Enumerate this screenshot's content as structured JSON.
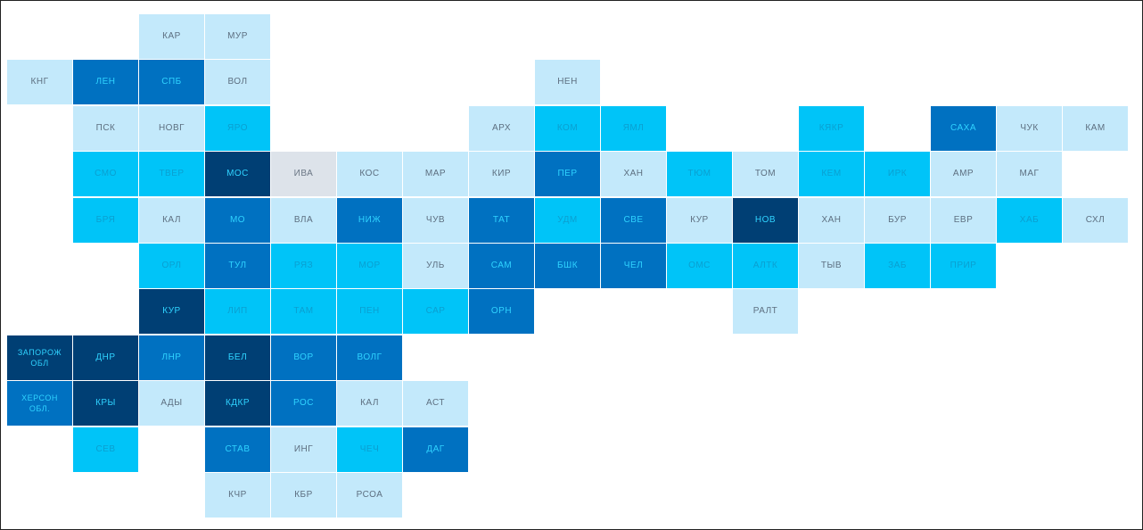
{
  "legend_colors": {
    "0": {
      "fill": "#dde3ea",
      "text": "#6b7785"
    },
    "1": {
      "fill": "#c3e9fb",
      "text": "#5d6f80"
    },
    "2": {
      "fill": "#00c4f8",
      "text": "#0a9fd0"
    },
    "3": {
      "fill": "#0071c1",
      "text": "#2fd3ff"
    },
    "4": {
      "fill": "#003f74",
      "text": "#2fd3ff"
    }
  },
  "tiles": [
    {
      "label": "КАР",
      "row": 0,
      "col": 2,
      "level": 1
    },
    {
      "label": "МУР",
      "row": 0,
      "col": 3,
      "level": 1
    },
    {
      "label": "КНГ",
      "row": 1,
      "col": 0,
      "level": 1
    },
    {
      "label": "ЛЕН",
      "row": 1,
      "col": 1,
      "level": 3
    },
    {
      "label": "СПБ",
      "row": 1,
      "col": 2,
      "level": 3
    },
    {
      "label": "ВОЛ",
      "row": 1,
      "col": 3,
      "level": 1
    },
    {
      "label": "НЕН",
      "row": 1,
      "col": 8,
      "level": 1
    },
    {
      "label": "ПСК",
      "row": 2,
      "col": 1,
      "level": 1
    },
    {
      "label": "НОВГ",
      "row": 2,
      "col": 2,
      "level": 1
    },
    {
      "label": "ЯРО",
      "row": 2,
      "col": 3,
      "level": 2
    },
    {
      "label": "АРХ",
      "row": 2,
      "col": 7,
      "level": 1
    },
    {
      "label": "КОМ",
      "row": 2,
      "col": 8,
      "level": 2
    },
    {
      "label": "ЯМЛ",
      "row": 2,
      "col": 9,
      "level": 2
    },
    {
      "label": "КЯКР",
      "row": 2,
      "col": 12,
      "level": 2
    },
    {
      "label": "САХА",
      "row": 2,
      "col": 14,
      "level": 3
    },
    {
      "label": "ЧУК",
      "row": 2,
      "col": 15,
      "level": 1
    },
    {
      "label": "КАМ",
      "row": 2,
      "col": 16,
      "level": 1
    },
    {
      "label": "СМО",
      "row": 3,
      "col": 1,
      "level": 2
    },
    {
      "label": "ТВЕР",
      "row": 3,
      "col": 2,
      "level": 2
    },
    {
      "label": "МОС",
      "row": 3,
      "col": 3,
      "level": 4
    },
    {
      "label": "ИВА",
      "row": 3,
      "col": 4,
      "level": 0
    },
    {
      "label": "КОС",
      "row": 3,
      "col": 5,
      "level": 1
    },
    {
      "label": "МАР",
      "row": 3,
      "col": 6,
      "level": 1
    },
    {
      "label": "КИР",
      "row": 3,
      "col": 7,
      "level": 1
    },
    {
      "label": "ПЕР",
      "row": 3,
      "col": 8,
      "level": 3
    },
    {
      "label": "ХАН",
      "row": 3,
      "col": 9,
      "level": 1
    },
    {
      "label": "ТЮМ",
      "row": 3,
      "col": 10,
      "level": 2
    },
    {
      "label": "ТОМ",
      "row": 3,
      "col": 11,
      "level": 1
    },
    {
      "label": "КЕМ",
      "row": 3,
      "col": 12,
      "level": 2
    },
    {
      "label": "ИРК",
      "row": 3,
      "col": 13,
      "level": 2
    },
    {
      "label": "АМР",
      "row": 3,
      "col": 14,
      "level": 1
    },
    {
      "label": "МАГ",
      "row": 3,
      "col": 15,
      "level": 1
    },
    {
      "label": "БРЯ",
      "row": 4,
      "col": 1,
      "level": 2
    },
    {
      "label": "КАЛ",
      "row": 4,
      "col": 2,
      "level": 1
    },
    {
      "label": "МО",
      "row": 4,
      "col": 3,
      "level": 3
    },
    {
      "label": "ВЛА",
      "row": 4,
      "col": 4,
      "level": 1
    },
    {
      "label": "НИЖ",
      "row": 4,
      "col": 5,
      "level": 3
    },
    {
      "label": "ЧУВ",
      "row": 4,
      "col": 6,
      "level": 1
    },
    {
      "label": "ТАТ",
      "row": 4,
      "col": 7,
      "level": 3
    },
    {
      "label": "УДМ",
      "row": 4,
      "col": 8,
      "level": 2
    },
    {
      "label": "СВЕ",
      "row": 4,
      "col": 9,
      "level": 3
    },
    {
      "label": "КУР",
      "row": 4,
      "col": 10,
      "level": 1
    },
    {
      "label": "НОВ",
      "row": 4,
      "col": 11,
      "level": 4
    },
    {
      "label": "ХАН",
      "row": 4,
      "col": 12,
      "level": 1
    },
    {
      "label": "БУР",
      "row": 4,
      "col": 13,
      "level": 1
    },
    {
      "label": "ЕВР",
      "row": 4,
      "col": 14,
      "level": 1
    },
    {
      "label": "ХАБ",
      "row": 4,
      "col": 15,
      "level": 2
    },
    {
      "label": "СХЛ",
      "row": 4,
      "col": 16,
      "level": 1
    },
    {
      "label": "ОРЛ",
      "row": 5,
      "col": 2,
      "level": 2
    },
    {
      "label": "ТУЛ",
      "row": 5,
      "col": 3,
      "level": 3
    },
    {
      "label": "РЯЗ",
      "row": 5,
      "col": 4,
      "level": 2
    },
    {
      "label": "МОР",
      "row": 5,
      "col": 5,
      "level": 2
    },
    {
      "label": "УЛЬ",
      "row": 5,
      "col": 6,
      "level": 1
    },
    {
      "label": "САМ",
      "row": 5,
      "col": 7,
      "level": 3
    },
    {
      "label": "БШК",
      "row": 5,
      "col": 8,
      "level": 3
    },
    {
      "label": "ЧЕЛ",
      "row": 5,
      "col": 9,
      "level": 3
    },
    {
      "label": "ОМС",
      "row": 5,
      "col": 10,
      "level": 2
    },
    {
      "label": "АЛТК",
      "row": 5,
      "col": 11,
      "level": 2
    },
    {
      "label": "ТЫВ",
      "row": 5,
      "col": 12,
      "level": 1
    },
    {
      "label": "ЗАБ",
      "row": 5,
      "col": 13,
      "level": 2
    },
    {
      "label": "ПРИР",
      "row": 5,
      "col": 14,
      "level": 2
    },
    {
      "label": "КУР",
      "row": 6,
      "col": 2,
      "level": 4
    },
    {
      "label": "ЛИП",
      "row": 6,
      "col": 3,
      "level": 2
    },
    {
      "label": "ТАМ",
      "row": 6,
      "col": 4,
      "level": 2
    },
    {
      "label": "ПЕН",
      "row": 6,
      "col": 5,
      "level": 2
    },
    {
      "label": "САР",
      "row": 6,
      "col": 6,
      "level": 2
    },
    {
      "label": "ОРН",
      "row": 6,
      "col": 7,
      "level": 3
    },
    {
      "label": "РАЛТ",
      "row": 6,
      "col": 11,
      "level": 1
    },
    {
      "label": "ЗАПОРОЖ ОБЛ",
      "row": 7,
      "col": 0,
      "level": 4
    },
    {
      "label": "ДНР",
      "row": 7,
      "col": 1,
      "level": 4
    },
    {
      "label": "ЛНР",
      "row": 7,
      "col": 2,
      "level": 3
    },
    {
      "label": "БЕЛ",
      "row": 7,
      "col": 3,
      "level": 4
    },
    {
      "label": "ВОР",
      "row": 7,
      "col": 4,
      "level": 3
    },
    {
      "label": "ВОЛГ",
      "row": 7,
      "col": 5,
      "level": 3
    },
    {
      "label": "ХЕРСОН ОБЛ.",
      "row": 8,
      "col": 0,
      "level": 3
    },
    {
      "label": "КРЫ",
      "row": 8,
      "col": 1,
      "level": 4
    },
    {
      "label": "АДЫ",
      "row": 8,
      "col": 2,
      "level": 1
    },
    {
      "label": "КДКР",
      "row": 8,
      "col": 3,
      "level": 4
    },
    {
      "label": "РОС",
      "row": 8,
      "col": 4,
      "level": 3
    },
    {
      "label": "КАЛ",
      "row": 8,
      "col": 5,
      "level": 1
    },
    {
      "label": "АСТ",
      "row": 8,
      "col": 6,
      "level": 1
    },
    {
      "label": "СЕВ",
      "row": 9,
      "col": 1,
      "level": 2
    },
    {
      "label": "СТАВ",
      "row": 9,
      "col": 3,
      "level": 3
    },
    {
      "label": "ИНГ",
      "row": 9,
      "col": 4,
      "level": 1
    },
    {
      "label": "ЧЕЧ",
      "row": 9,
      "col": 5,
      "level": 2
    },
    {
      "label": "ДАГ",
      "row": 9,
      "col": 6,
      "level": 3
    },
    {
      "label": "КЧР",
      "row": 10,
      "col": 3,
      "level": 1
    },
    {
      "label": "КБР",
      "row": 10,
      "col": 4,
      "level": 1
    },
    {
      "label": "РСОА",
      "row": 10,
      "col": 5,
      "level": 1
    }
  ]
}
